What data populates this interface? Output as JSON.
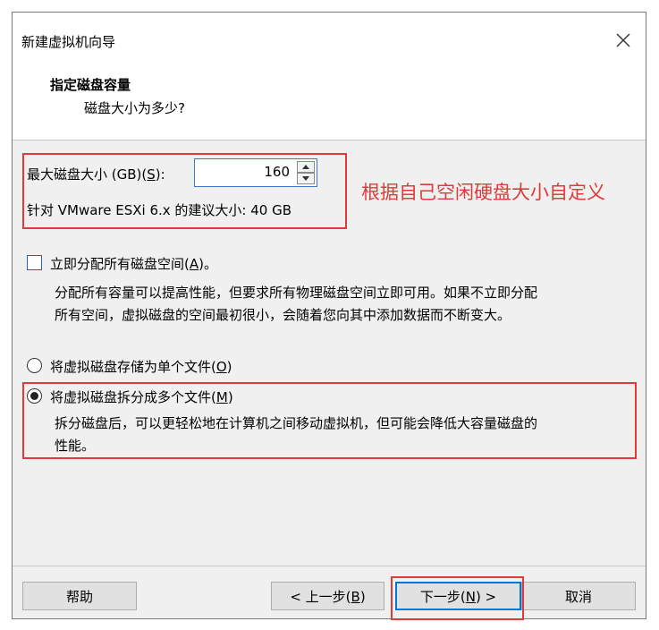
{
  "window": {
    "title": "新建虚拟机向导"
  },
  "header": {
    "title": "指定磁盘容量",
    "subtitle": "磁盘大小为多少?"
  },
  "disk": {
    "max_label_prefix": "最大磁盘大小 (GB)(",
    "max_label_key": "S",
    "max_label_suffix": "):",
    "value": "160",
    "recommend": "针对 VMware ESXi 6.x 的建议大小: 40 GB"
  },
  "annotation": "根据自己空闲硬盘大小自定义",
  "allocate": {
    "label_prefix": "立即分配所有磁盘空间(",
    "label_key": "A",
    "label_suffix": ")。",
    "checked": false,
    "desc_line1": "分配所有容量可以提高性能，但要求所有物理磁盘空间立即可用。如果不立即分配",
    "desc_line2": "所有空间，虚拟磁盘的空间最初很小，会随着您向其中添加数据而不断变大。"
  },
  "options": {
    "single": {
      "label_prefix": "将虚拟磁盘存储为单个文件(",
      "label_key": "O",
      "label_suffix": ")",
      "selected": false
    },
    "multi": {
      "label_prefix": "将虚拟磁盘拆分成多个文件(",
      "label_key": "M",
      "label_suffix": ")",
      "selected": true,
      "desc_line1": "拆分磁盘后，可以更轻松地在计算机之间移动虚拟机，但可能会降低大容量磁盘的",
      "desc_line2": "性能。"
    }
  },
  "buttons": {
    "help": "帮助",
    "back_prefix": "< 上一步(",
    "back_key": "B",
    "back_suffix": ")",
    "next_prefix": "下一步(",
    "next_key": "N",
    "next_suffix": ") >",
    "cancel": "取消"
  },
  "colors": {
    "annotation": "#e03a3a",
    "accent": "#0078d7"
  }
}
